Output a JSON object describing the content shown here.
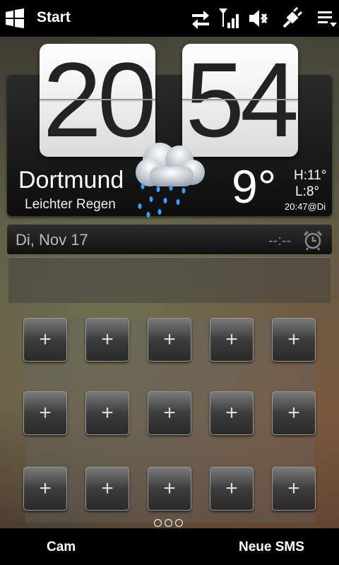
{
  "status_bar": {
    "title": "Start",
    "icons": [
      "windows-logo-icon",
      "data-sync-icon",
      "signal-icon",
      "volume-mute-icon",
      "power-icon",
      "menu-icon"
    ]
  },
  "clock": {
    "hours": "20",
    "minutes": "54"
  },
  "weather": {
    "city": "Dortmund",
    "condition": "Leichter Regen",
    "temperature": "9°",
    "high": "H:11°",
    "low": "L:8°",
    "updated": "20:47@Di",
    "icon": "rain-cloud-icon"
  },
  "date_bar": {
    "date": "Di, Nov 17",
    "alarm": "--:--"
  },
  "shortcut_tile_label": "+",
  "pager": {
    "pages": 3,
    "active": 0
  },
  "softkeys": {
    "left": "Cam",
    "right": "Neue SMS"
  }
}
